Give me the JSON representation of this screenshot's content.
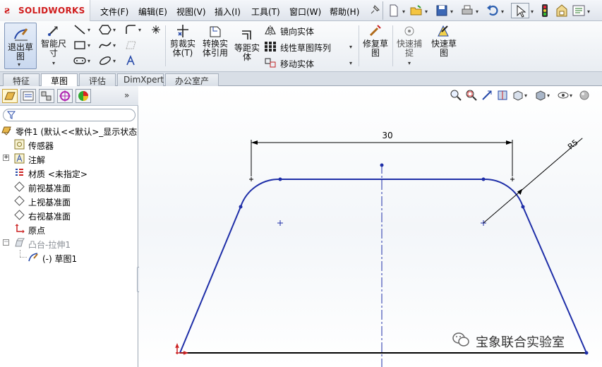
{
  "app": {
    "logo_text": "SOLIDWORKS",
    "menus": [
      "文件(F)",
      "编辑(E)",
      "视图(V)",
      "插入(I)",
      "工具(T)",
      "窗口(W)",
      "帮助(H)"
    ]
  },
  "commands": {
    "exit_sketch": "退出草图",
    "smart_dimension": "智能尺寸",
    "trim_entities": "剪裁实体(T)",
    "convert_entities": "转换实体引用",
    "offset_entities": "等距实体",
    "mirror_entities": "镜向实体",
    "linear_pattern": "线性草图阵列",
    "move_entities": "移动实体",
    "repair_sketch": "修复草图",
    "quick_snaps": "快速捕捉",
    "rapid_sketch": "快速草图"
  },
  "tabs": [
    "特征",
    "草图",
    "评估",
    "DimXpert",
    "办公室产品"
  ],
  "active_tab": "草图",
  "tree": {
    "root": "零件1 (默认<<默认>_显示状态",
    "items": [
      {
        "label": "传感器",
        "icon": "sensor-icon"
      },
      {
        "label": "注解",
        "icon": "annotation-icon"
      },
      {
        "label": "材质 <未指定>",
        "icon": "material-icon"
      },
      {
        "label": "前视基准面",
        "icon": "plane-icon"
      },
      {
        "label": "上视基准面",
        "icon": "plane-icon"
      },
      {
        "label": "右视基准面",
        "icon": "plane-icon"
      },
      {
        "label": "原点",
        "icon": "origin-icon"
      },
      {
        "label": "凸台-拉伸1",
        "icon": "extrude-icon"
      },
      {
        "label": "(-) 草图1",
        "icon": "sketch-icon"
      }
    ]
  },
  "sketch": {
    "width_dimension": "30",
    "radius_dimension": "R5",
    "line_color": "#1f2fa8"
  },
  "watermark": "宝象联合实验室",
  "colors": {
    "accent": "#d01c1c",
    "sketch_line": "#1f2fa8"
  }
}
